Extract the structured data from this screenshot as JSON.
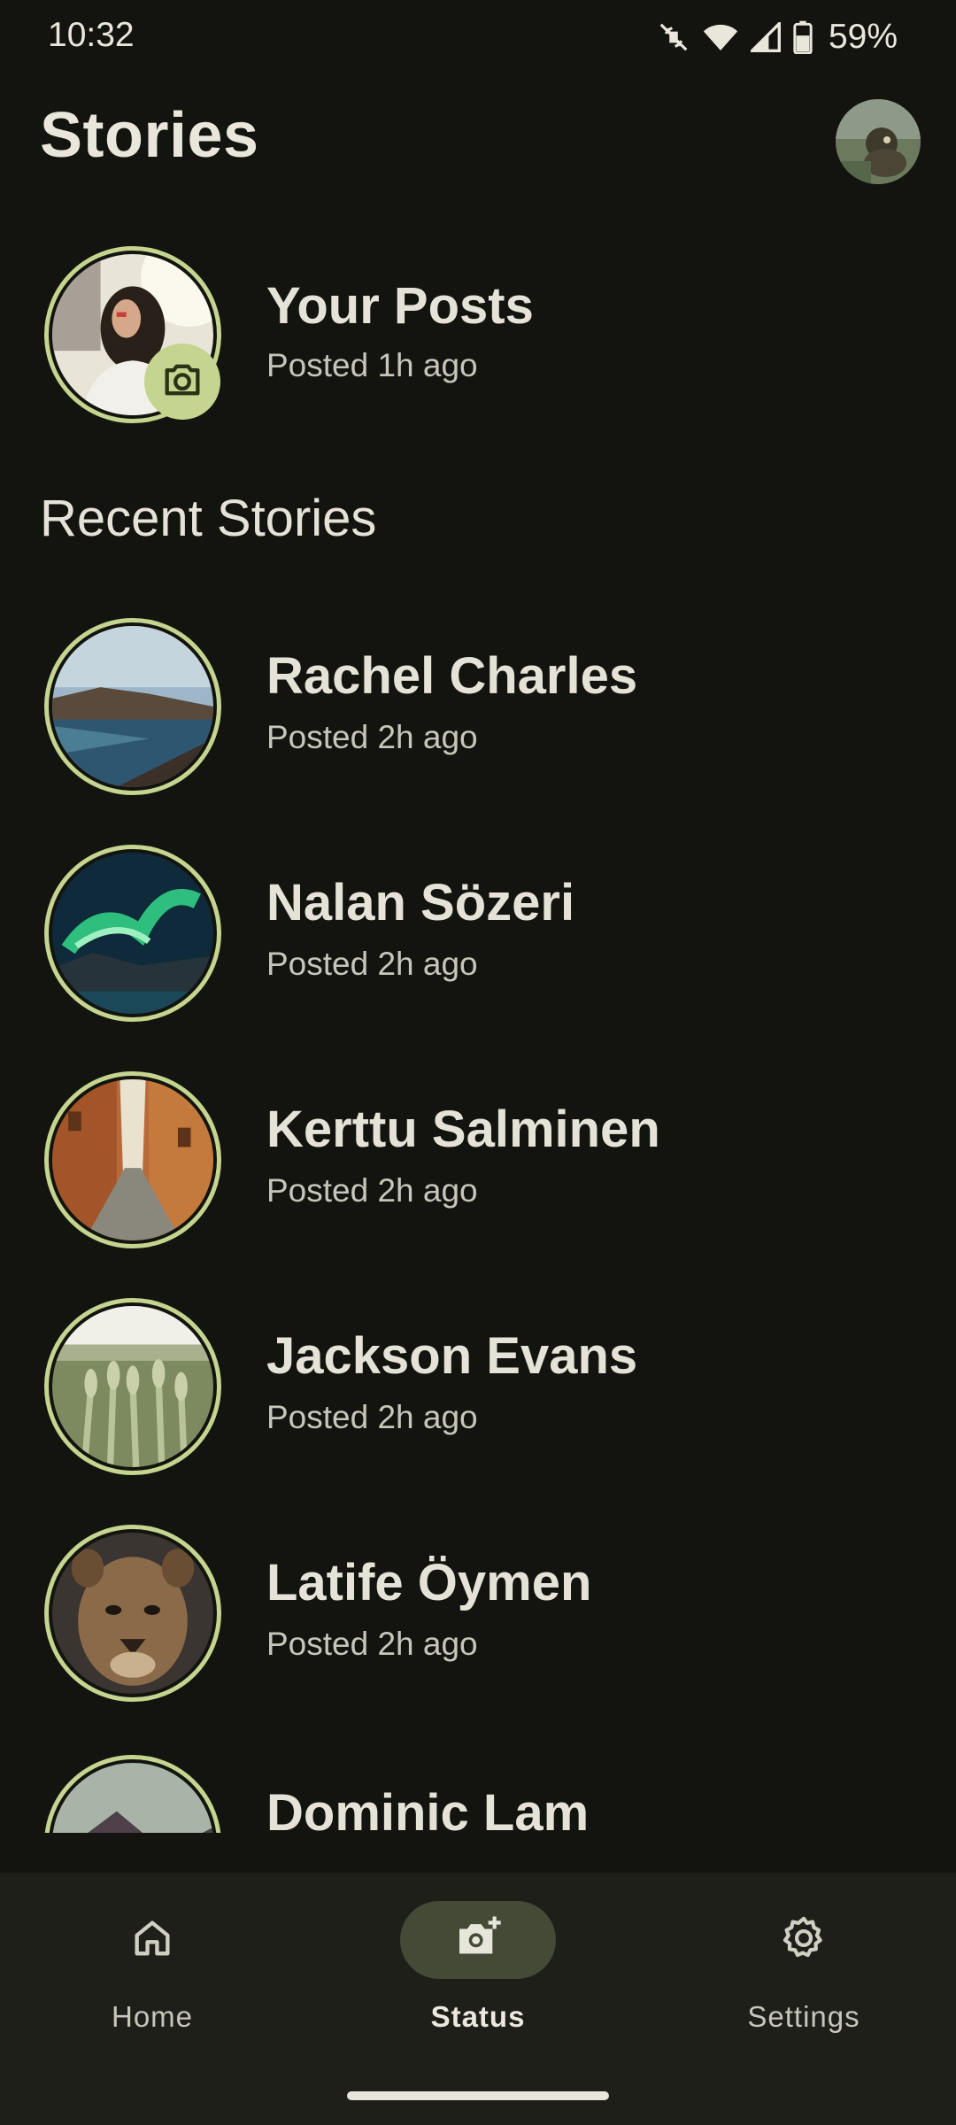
{
  "status_bar": {
    "time": "10:32",
    "battery": "59%"
  },
  "header": {
    "title": "Stories"
  },
  "own_post": {
    "name": "Your Posts",
    "time": "Posted 1h ago"
  },
  "recent": {
    "title": "Recent Stories",
    "items": [
      {
        "name": "Rachel Charles",
        "time": "Posted 2h ago"
      },
      {
        "name": "Nalan Sözeri",
        "time": "Posted 2h ago"
      },
      {
        "name": "Kerttu Salminen",
        "time": "Posted 2h ago"
      },
      {
        "name": "Jackson Evans",
        "time": "Posted 2h ago"
      },
      {
        "name": "Latife Öymen",
        "time": "Posted 2h ago"
      },
      {
        "name": "Dominic Lam"
      }
    ]
  },
  "nav": {
    "items": [
      {
        "label": "Home",
        "icon": "home-icon",
        "active": false
      },
      {
        "label": "Status",
        "icon": "add-photo-icon",
        "active": true
      },
      {
        "label": "Settings",
        "icon": "gear-icon",
        "active": false
      }
    ]
  },
  "colors": {
    "background": "#13140f",
    "accent": "#c5d48f",
    "nav_background": "#1e1f19",
    "nav_active_pill": "#444a36"
  }
}
